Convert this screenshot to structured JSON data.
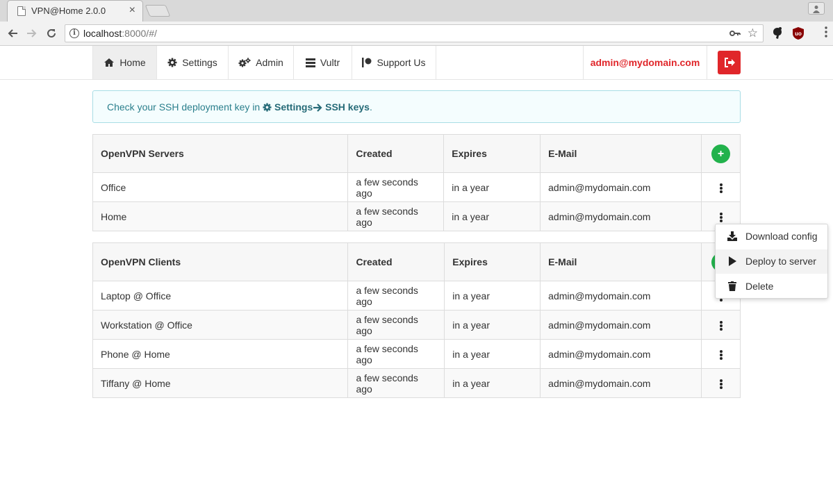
{
  "browser": {
    "tab_title": "VPN@Home 2.0.0",
    "tab_close": "×",
    "url_host": "localhost",
    "url_rest": ":8000/#/"
  },
  "nav": {
    "items": [
      {
        "label": "Home",
        "icon": "home-icon",
        "active": true
      },
      {
        "label": "Settings",
        "icon": "gear-icon"
      },
      {
        "label": "Admin",
        "icon": "gears-icon"
      },
      {
        "label": "Vultr",
        "icon": "server-icon"
      },
      {
        "label": "Support Us",
        "icon": "patreon-icon"
      }
    ],
    "user": "admin@mydomain.com",
    "logout_icon": "sign-out-icon"
  },
  "alert": {
    "text_before": "Check your SSH deployment key in ",
    "link_settings": "Settings",
    "link_ssh": " SSH keys",
    "text_after": "."
  },
  "servers_table": {
    "headers": [
      "OpenVPN Servers",
      "Created",
      "Expires",
      "E-Mail"
    ],
    "add_label": "+",
    "rows": [
      {
        "name": "Office",
        "created": "a few seconds ago",
        "expires": "in a year",
        "email": "admin@mydomain.com"
      },
      {
        "name": "Home",
        "created": "a few seconds ago",
        "expires": "in a year",
        "email": "admin@mydomain.com"
      }
    ]
  },
  "clients_table": {
    "headers": [
      "OpenVPN Clients",
      "Created",
      "Expires",
      "E-Mail"
    ],
    "rows": [
      {
        "name": "Laptop @ Office",
        "created": "a few seconds ago",
        "expires": "in a year",
        "email": "admin@mydomain.com"
      },
      {
        "name": "Workstation @ Office",
        "created": "a few seconds ago",
        "expires": "in a year",
        "email": "admin@mydomain.com"
      },
      {
        "name": "Phone @ Home",
        "created": "a few seconds ago",
        "expires": "in a year",
        "email": "admin@mydomain.com"
      },
      {
        "name": "Tiffany @ Home",
        "created": "a few seconds ago",
        "expires": "in a year",
        "email": "admin@mydomain.com"
      }
    ]
  },
  "dropdown": {
    "items": [
      {
        "label": "Download config",
        "icon": "download-icon"
      },
      {
        "label": "Deploy to server",
        "icon": "play-icon"
      },
      {
        "label": "Delete",
        "icon": "trash-icon"
      }
    ]
  },
  "colors": {
    "brand_red": "#e0262a",
    "success_green": "#22b24c",
    "info_text": "#2a7f8c"
  }
}
